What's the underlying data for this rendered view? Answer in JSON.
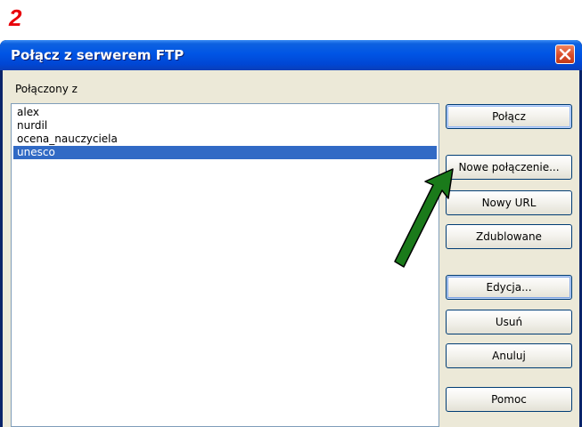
{
  "step_number": "2",
  "window": {
    "title": "Połącz z serwerem FTP"
  },
  "list": {
    "label": "Połączony z",
    "items": [
      {
        "text": "alex",
        "selected": false
      },
      {
        "text": "nurdil",
        "selected": false
      },
      {
        "text": "ocena_nauczyciela",
        "selected": false
      },
      {
        "text": "unesco",
        "selected": true
      }
    ]
  },
  "buttons": {
    "connect": "Połącz",
    "new_connection": "Nowe połączenie...",
    "new_url": "Nowy URL",
    "duplicate": "Zdublowane",
    "edit": "Edycja...",
    "delete": "Usuń",
    "cancel": "Anuluj",
    "help": "Pomoc"
  },
  "colors": {
    "step_number": "#e8000a",
    "arrow": "#1a7a1a",
    "selection": "#316ac5",
    "titlebar": "#0055e5",
    "close_button": "#d94c2a"
  },
  "icons": {
    "close": "close-icon",
    "annotation": "green-arrow-icon"
  }
}
